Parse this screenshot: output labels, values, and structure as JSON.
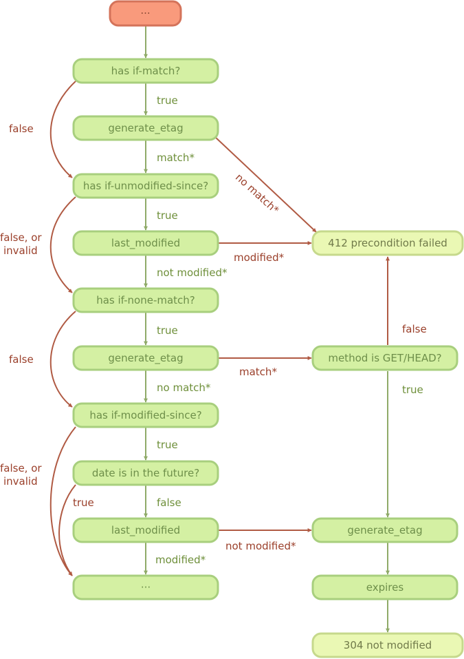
{
  "colors": {
    "start_fill": "#f99a7c",
    "start_stroke": "#d4735a",
    "start_text": "#8a4a35",
    "node_fill": "#d4f0a3",
    "node_stroke": "#a8cf7e",
    "node_text": "#6e8f4a",
    "terminal_fill": "#eaf8b4",
    "terminal_stroke": "#c6d98c",
    "terminal_text": "#707a4a",
    "edge_true": "#8faa68",
    "edge_false": "#b05a43",
    "label_true": "#6e8f3a",
    "label_false": "#9a3f2a"
  },
  "nodes": [
    {
      "id": "start",
      "label": "...",
      "kind": "start"
    },
    {
      "id": "has-if-match",
      "label": "has if-match?",
      "kind": "step"
    },
    {
      "id": "generate-etag-1",
      "label": "generate_etag",
      "kind": "step"
    },
    {
      "id": "has-if-unmodified-since",
      "label": "has if-unmodified-since?",
      "kind": "step"
    },
    {
      "id": "last-modified-1",
      "label": "last_modified",
      "kind": "step"
    },
    {
      "id": "has-if-none-match",
      "label": "has if-none-match?",
      "kind": "step"
    },
    {
      "id": "generate-etag-2",
      "label": "generate_etag",
      "kind": "step"
    },
    {
      "id": "has-if-modified-since",
      "label": "has if-modified-since?",
      "kind": "step"
    },
    {
      "id": "date-in-future",
      "label": "date is in the future?",
      "kind": "step"
    },
    {
      "id": "last-modified-2",
      "label": "last_modified",
      "kind": "step"
    },
    {
      "id": "continue",
      "label": "...",
      "kind": "step"
    },
    {
      "id": "precondition-failed",
      "label": "412 precondition failed",
      "kind": "terminal"
    },
    {
      "id": "method-get-head",
      "label": "method is GET/HEAD?",
      "kind": "step"
    },
    {
      "id": "generate-etag-3",
      "label": "generate_etag",
      "kind": "step"
    },
    {
      "id": "expires",
      "label": "expires",
      "kind": "step"
    },
    {
      "id": "not-modified",
      "label": "304 not modified",
      "kind": "terminal"
    }
  ],
  "edges": [
    {
      "from": "start",
      "to": "has-if-match",
      "label": "",
      "type": "true"
    },
    {
      "from": "has-if-match",
      "to": "generate-etag-1",
      "label": "true",
      "type": "true"
    },
    {
      "from": "has-if-match",
      "to": "has-if-unmodified-since",
      "label": "false",
      "type": "false"
    },
    {
      "from": "generate-etag-1",
      "to": "has-if-unmodified-since",
      "label": "match*",
      "type": "true"
    },
    {
      "from": "generate-etag-1",
      "to": "precondition-failed",
      "label": "no match*",
      "type": "false"
    },
    {
      "from": "has-if-unmodified-since",
      "to": "last-modified-1",
      "label": "true",
      "type": "true"
    },
    {
      "from": "has-if-unmodified-since",
      "to": "has-if-none-match",
      "label": "false, or\ninvalid",
      "type": "false"
    },
    {
      "from": "last-modified-1",
      "to": "has-if-none-match",
      "label": "not modified*",
      "type": "true"
    },
    {
      "from": "last-modified-1",
      "to": "precondition-failed",
      "label": "modified*",
      "type": "false"
    },
    {
      "from": "has-if-none-match",
      "to": "generate-etag-2",
      "label": "true",
      "type": "true"
    },
    {
      "from": "has-if-none-match",
      "to": "has-if-modified-since",
      "label": "false",
      "type": "false"
    },
    {
      "from": "generate-etag-2",
      "to": "has-if-modified-since",
      "label": "no match*",
      "type": "true"
    },
    {
      "from": "generate-etag-2",
      "to": "method-get-head",
      "label": "match*",
      "type": "false"
    },
    {
      "from": "method-get-head",
      "to": "precondition-failed",
      "label": "false",
      "type": "false"
    },
    {
      "from": "method-get-head",
      "to": "generate-etag-3",
      "label": "true",
      "type": "true"
    },
    {
      "from": "has-if-modified-since",
      "to": "date-in-future",
      "label": "true",
      "type": "true"
    },
    {
      "from": "has-if-modified-since",
      "to": "continue",
      "label": "false, or\ninvalid",
      "type": "false"
    },
    {
      "from": "date-in-future",
      "to": "last-modified-2",
      "label": "false",
      "type": "true"
    },
    {
      "from": "date-in-future",
      "to": "continue",
      "label": "true",
      "type": "false"
    },
    {
      "from": "last-modified-2",
      "to": "continue",
      "label": "modified*",
      "type": "true"
    },
    {
      "from": "last-modified-2",
      "to": "generate-etag-3",
      "label": "not modified*",
      "type": "false"
    },
    {
      "from": "generate-etag-3",
      "to": "expires",
      "label": "",
      "type": "true"
    },
    {
      "from": "expires",
      "to": "not-modified",
      "label": "",
      "type": "true"
    }
  ]
}
